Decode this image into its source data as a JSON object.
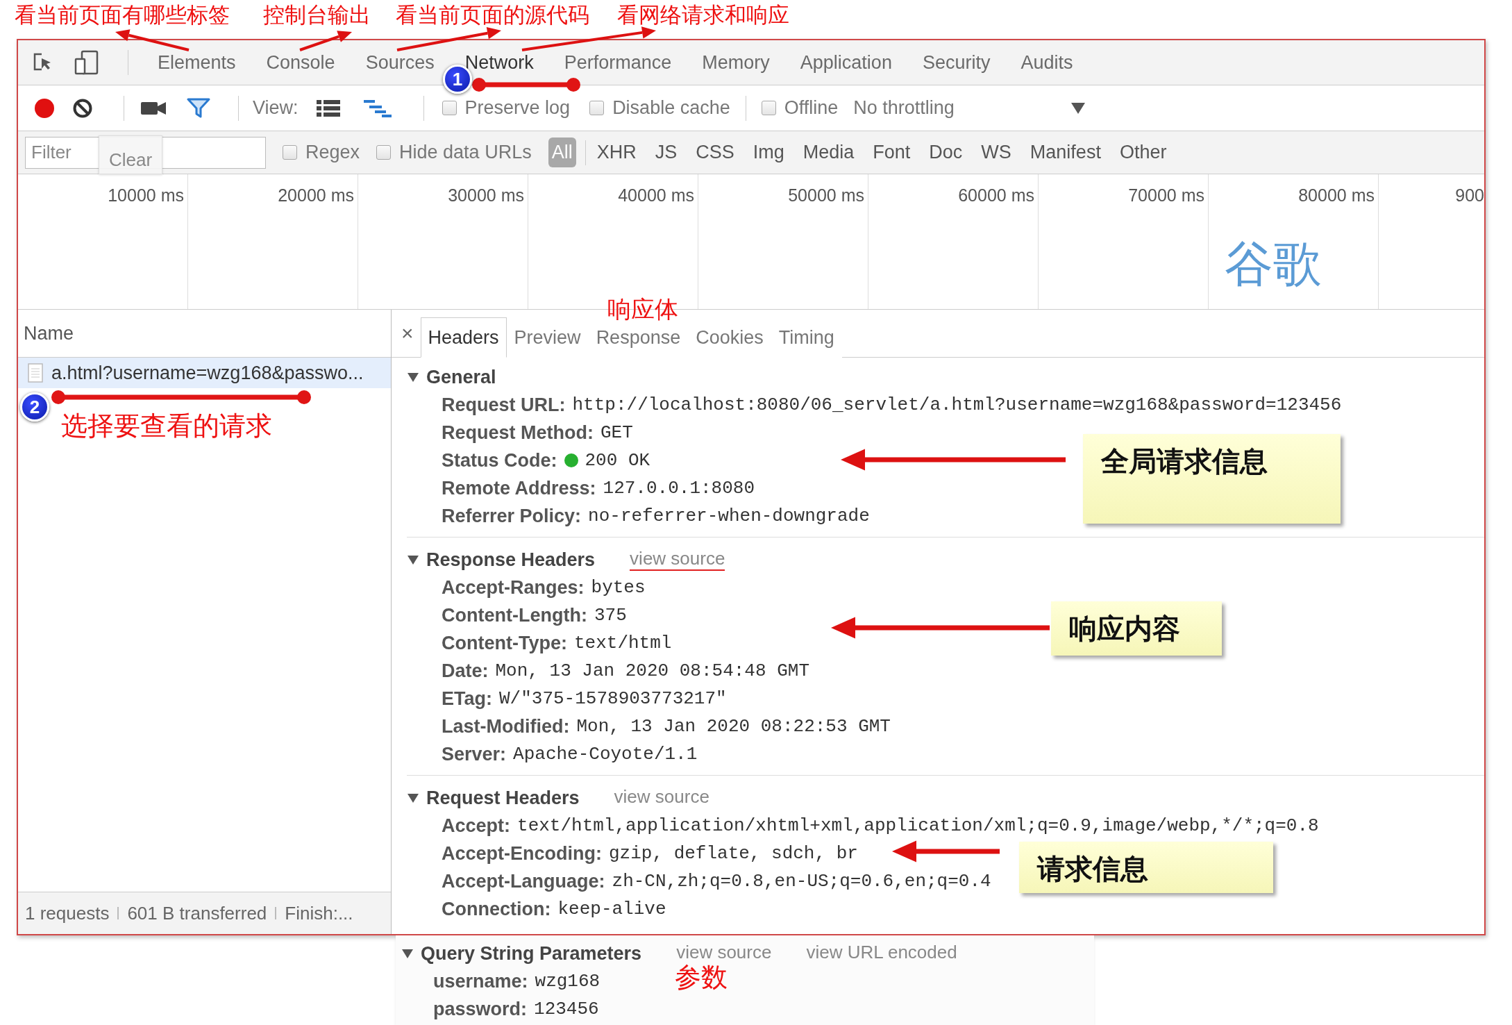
{
  "annotations": {
    "labels": [
      "看当前页面有哪些标签",
      "控制台输出",
      "看当前页面的源代码",
      "看网络请求和响应",
      "响应体",
      "选择要查看的请求",
      "参数"
    ],
    "brand_text": "谷歌",
    "callouts": [
      "全局请求信息",
      "响应内容",
      "请求信息"
    ],
    "markers": [
      "1",
      "2"
    ]
  },
  "main_tabs": [
    {
      "label": "Elements",
      "selected": false
    },
    {
      "label": "Console",
      "selected": false
    },
    {
      "label": "Sources",
      "selected": false
    },
    {
      "label": "Network",
      "selected": true
    },
    {
      "label": "Performance",
      "selected": false
    },
    {
      "label": "Memory",
      "selected": false
    },
    {
      "label": "Application",
      "selected": false
    },
    {
      "label": "Security",
      "selected": false
    },
    {
      "label": "Audits",
      "selected": false
    }
  ],
  "toolbar": {
    "recording": true,
    "view_label": "View:",
    "checkboxes": [
      {
        "label": "Preserve log",
        "checked": false
      },
      {
        "label": "Disable cache",
        "checked": false
      }
    ],
    "offline": {
      "label": "Offline",
      "checked": false
    },
    "throttling": "No throttling"
  },
  "filter": {
    "placeholder": "Filter",
    "tooltip": "Clear",
    "checkboxes": [
      {
        "label": "Regex",
        "checked": false
      },
      {
        "label": "Hide data URLs",
        "checked": false
      }
    ],
    "types": [
      {
        "label": "All",
        "selected": true
      },
      {
        "label": "XHR",
        "selected": false
      },
      {
        "label": "JS",
        "selected": false
      },
      {
        "label": "CSS",
        "selected": false
      },
      {
        "label": "Img",
        "selected": false
      },
      {
        "label": "Media",
        "selected": false
      },
      {
        "label": "Font",
        "selected": false
      },
      {
        "label": "Doc",
        "selected": false
      },
      {
        "label": "WS",
        "selected": false
      },
      {
        "label": "Manifest",
        "selected": false
      },
      {
        "label": "Other",
        "selected": false
      }
    ]
  },
  "timeline": {
    "ticks": [
      "10000 ms",
      "20000 ms",
      "30000 ms",
      "40000 ms",
      "50000 ms",
      "60000 ms",
      "70000 ms",
      "80000 ms",
      "900"
    ]
  },
  "requests": {
    "column": "Name",
    "rows": [
      {
        "name": "a.html?username=wzg168&passwo...",
        "selected": true
      }
    ]
  },
  "summary": [
    "1 requests",
    "601 B transferred",
    "Finish:..."
  ],
  "details": {
    "close": "×",
    "tabs": [
      {
        "label": "Headers",
        "selected": true
      },
      {
        "label": "Preview",
        "selected": false
      },
      {
        "label": "Response",
        "selected": false
      },
      {
        "label": "Cookies",
        "selected": false
      },
      {
        "label": "Timing",
        "selected": false
      }
    ],
    "sections": [
      {
        "title": "General",
        "expanded": true,
        "rows": [
          {
            "key": "Request URL:",
            "value": "http://localhost:8080/06_servlet/a.html?username=wzg168&password=123456",
            "kind": "text"
          },
          {
            "key": "Request Method:",
            "value": "GET",
            "kind": "text"
          },
          {
            "key": "Status Code:",
            "value": "200 OK",
            "kind": "status"
          },
          {
            "key": "Remote Address:",
            "value": "127.0.0.1:8080",
            "kind": "text"
          },
          {
            "key": "Referrer Policy:",
            "value": "no-referrer-when-downgrade",
            "kind": "text"
          }
        ]
      },
      {
        "title": "Response Headers",
        "expanded": true,
        "links": [
          {
            "label": "view source",
            "underlined": true
          }
        ],
        "rows": [
          {
            "key": "Accept-Ranges:",
            "value": "bytes",
            "kind": "text"
          },
          {
            "key": "Content-Length:",
            "value": "375",
            "kind": "text"
          },
          {
            "key": "Content-Type:",
            "value": "text/html",
            "kind": "text"
          },
          {
            "key": "Date:",
            "value": "Mon, 13 Jan 2020 08:54:48 GMT",
            "kind": "text"
          },
          {
            "key": "ETag:",
            "value": "W/\"375-1578903773217\"",
            "kind": "text"
          },
          {
            "key": "Last-Modified:",
            "value": "Mon, 13 Jan 2020 08:22:53 GMT",
            "kind": "text"
          },
          {
            "key": "Server:",
            "value": "Apache-Coyote/1.1",
            "kind": "text"
          }
        ]
      },
      {
        "title": "Request Headers",
        "expanded": true,
        "links": [
          {
            "label": "view source",
            "underlined": false
          }
        ],
        "rows": [
          {
            "key": "Accept:",
            "value": "text/html,application/xhtml+xml,application/xml;q=0.9,image/webp,*/*;q=0.8",
            "kind": "text"
          },
          {
            "key": "Accept-Encoding:",
            "value": "gzip, deflate, sdch, br",
            "kind": "text"
          },
          {
            "key": "Accept-Language:",
            "value": "zh-CN,zh;q=0.8,en-US;q=0.6,en;q=0.4",
            "kind": "text"
          },
          {
            "key": "Connection:",
            "value": "keep-alive",
            "kind": "text"
          }
        ]
      }
    ]
  },
  "query_string": {
    "title": "Query String Parameters",
    "expanded": true,
    "links": [
      {
        "label": "view source",
        "underlined": false
      },
      {
        "label": "view URL encoded",
        "underlined": false
      }
    ],
    "rows": [
      {
        "key": "username:",
        "value": "wzg168",
        "kind": "text"
      },
      {
        "key": "password:",
        "value": "123456",
        "kind": "text"
      }
    ]
  }
}
